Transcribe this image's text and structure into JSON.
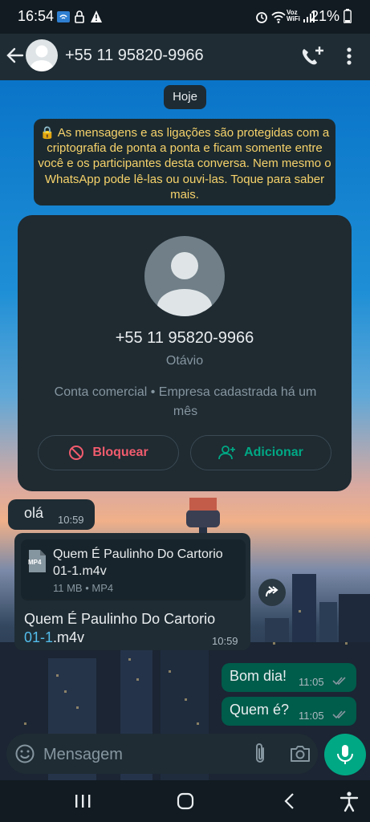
{
  "status_bar": {
    "time": "16:54",
    "battery": "21%",
    "voz_wifi": "Voz\nWiFi"
  },
  "header": {
    "title": "+55 11 95820-9966"
  },
  "chat": {
    "date_chip": "Hoje",
    "encryption_notice": "🔒 As mensagens e as ligações são protegidas com a criptografia de ponta a ponta e ficam somente entre você e os participantes desta conversa. Nem mesmo o WhatsApp pode lê-las ou ouvi-las. Toque para saber mais."
  },
  "contact_card": {
    "phone": "+55 11 95820-9966",
    "name": "Otávio",
    "business_info": "Conta comercial • Empresa cadastrada há um mês",
    "block_label": "Bloquear",
    "add_label": "Adicionar"
  },
  "messages": [
    {
      "direction": "in",
      "text": "olá",
      "time": "10:59"
    },
    {
      "direction": "in",
      "file_type_badge": "MP4",
      "file_name": "Quem É Paulinho Do Cartorio 01-1.m4v",
      "file_meta": "11 MB • MP4",
      "caption_part1": "Quem É Paulinho Do Cartorio ",
      "caption_link": "01-1",
      "caption_part2": ".m4v",
      "time": "10:59"
    },
    {
      "direction": "out",
      "text": "Bom dia!",
      "time": "11:05"
    },
    {
      "direction": "out",
      "text": "Quem é?",
      "time": "11:05"
    }
  ],
  "composer": {
    "placeholder": "Mensagem"
  },
  "colors": {
    "accent": "#00a884",
    "outgoing_bubble": "#005c4b",
    "incoming_bubble": "#1f2c34",
    "danger": "#f15c6d",
    "notice_text": "#f7d26b",
    "link": "#53bdeb"
  },
  "icons": [
    "back-arrow-icon",
    "call-add-icon",
    "more-vert-icon",
    "block-icon",
    "person-add-icon",
    "file-icon",
    "forward-icon",
    "double-check-icon",
    "emoji-icon",
    "attach-icon",
    "camera-icon",
    "mic-icon",
    "recents-icon",
    "home-icon",
    "nav-back-icon",
    "accessibility-icon"
  ]
}
